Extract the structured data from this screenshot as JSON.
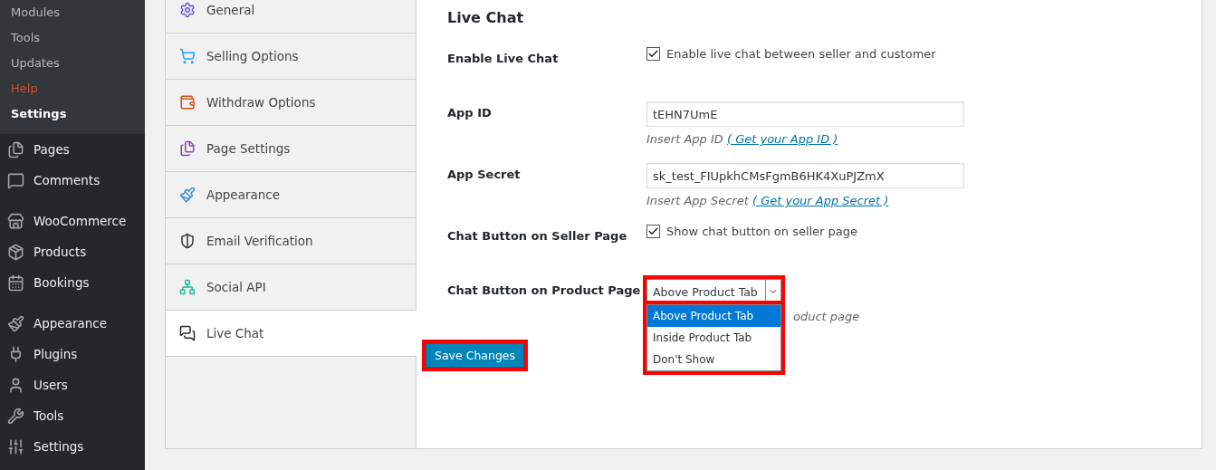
{
  "sidebar": {
    "submenu": [
      {
        "label": "Modules",
        "current": false,
        "hovered": false
      },
      {
        "label": "Tools",
        "current": false,
        "hovered": false
      },
      {
        "label": "Updates",
        "current": false,
        "hovered": false
      },
      {
        "label": "Help",
        "current": false,
        "hovered": true
      },
      {
        "label": "Settings",
        "current": true,
        "hovered": false
      }
    ],
    "items": [
      {
        "label": "Pages",
        "group_start": false
      },
      {
        "label": "Comments",
        "group_start": false
      },
      {
        "label": "WooCommerce",
        "group_start": true
      },
      {
        "label": "Products",
        "group_start": false
      },
      {
        "label": "Bookings",
        "group_start": false
      },
      {
        "label": "Appearance",
        "group_start": true
      },
      {
        "label": "Plugins",
        "group_start": false
      },
      {
        "label": "Users",
        "group_start": false
      },
      {
        "label": "Tools",
        "group_start": false
      },
      {
        "label": "Settings",
        "group_start": false
      }
    ]
  },
  "settings_tabs": [
    {
      "label": "General",
      "selected": false
    },
    {
      "label": "Selling Options",
      "selected": false
    },
    {
      "label": "Withdraw Options",
      "selected": false
    },
    {
      "label": "Page Settings",
      "selected": false
    },
    {
      "label": "Appearance",
      "selected": false
    },
    {
      "label": "Email Verification",
      "selected": false
    },
    {
      "label": "Social API",
      "selected": false
    },
    {
      "label": "Live Chat",
      "selected": true
    }
  ],
  "section_title": "Live Chat",
  "fields": [
    {
      "kind": "checkbox",
      "label": "Enable Live Chat",
      "text": "Enable live chat between seller and customer",
      "checked": true
    },
    {
      "kind": "text",
      "label": "App ID",
      "value": "tEHN7UmE",
      "help": "Insert App ID",
      "link": "( Get your App ID )"
    },
    {
      "kind": "text",
      "label": "App Secret",
      "value": "sk_test_FIUpkhCMsFgmB6HK4XuPJZmX",
      "help": "Insert App Secret",
      "link": "( Get your App Secret )"
    },
    {
      "kind": "checkbox",
      "label": "Chat Button on Seller Page",
      "text": "Show chat button on seller page",
      "checked": true
    },
    {
      "kind": "select",
      "label": "Chat Button on Product Page",
      "value": "Above Product Tab",
      "expanded": true,
      "highlighted": true,
      "help": "oduct page",
      "options": [
        {
          "label": "Above Product Tab",
          "selected": true
        },
        {
          "label": "Inside Product Tab",
          "selected": false
        },
        {
          "label": "Don't Show",
          "selected": false
        }
      ]
    }
  ],
  "save_button": {
    "label": "Save Changes",
    "highlighted": true
  }
}
